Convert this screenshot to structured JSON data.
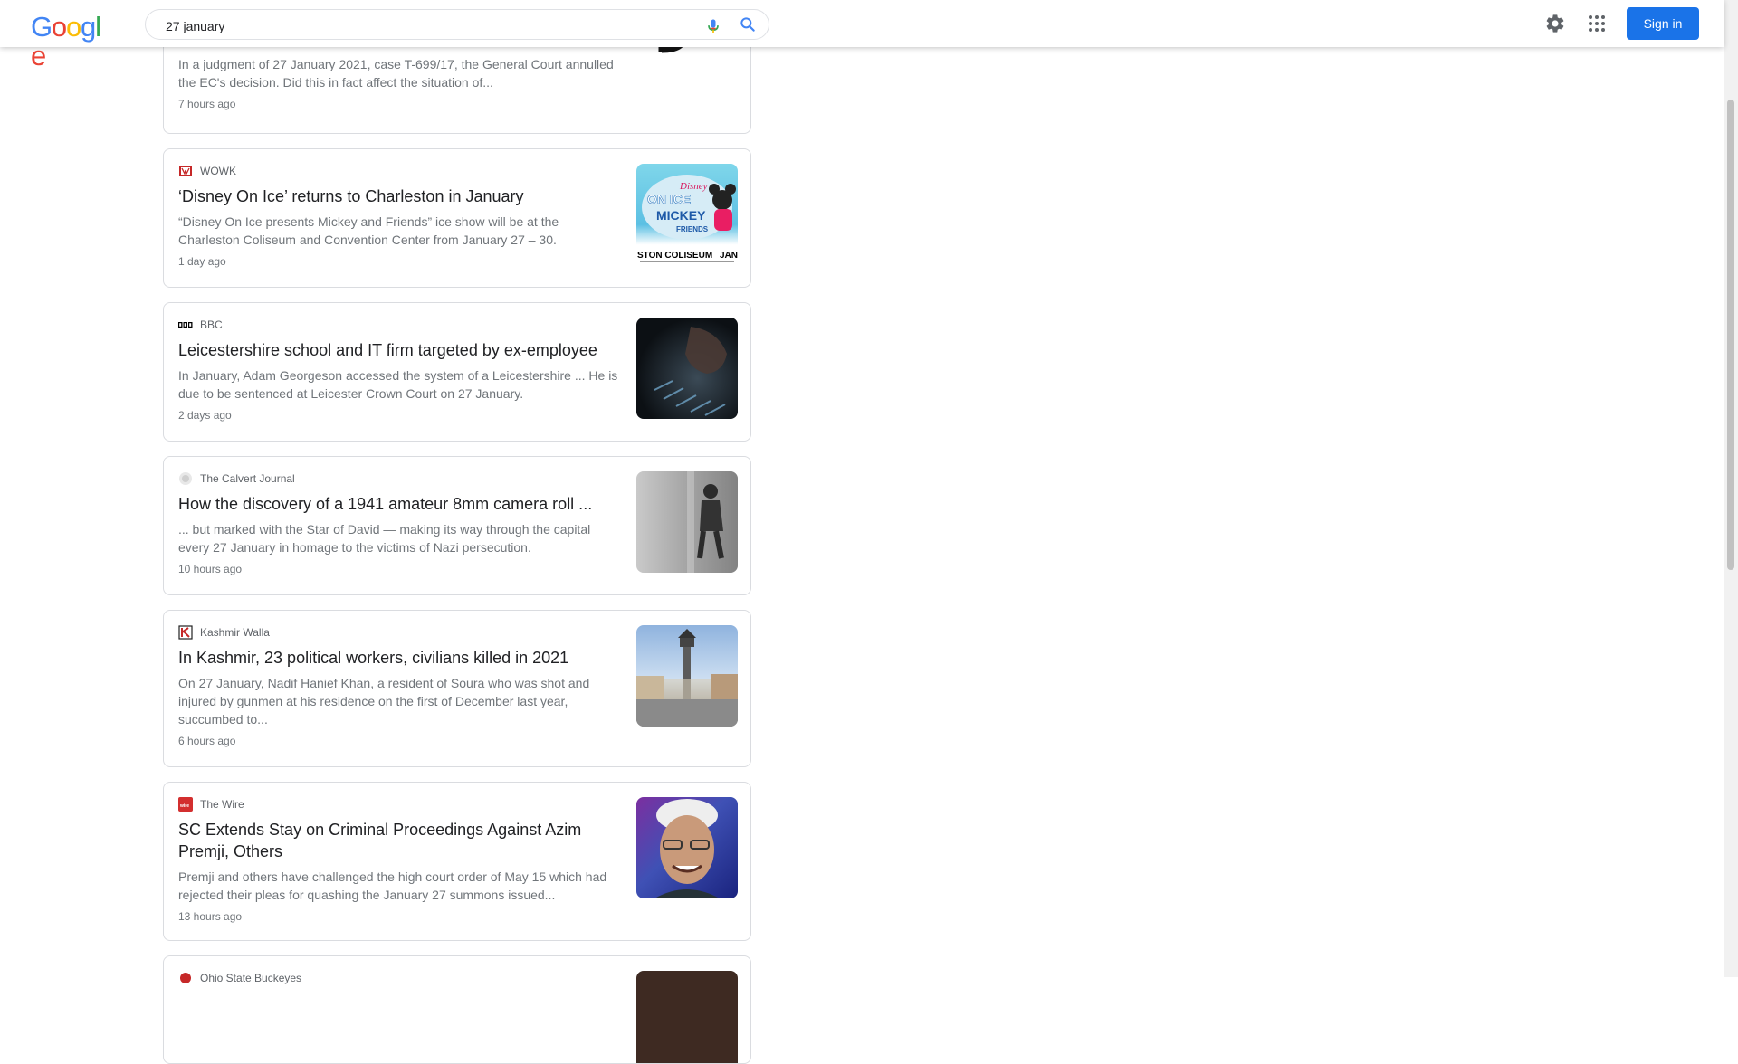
{
  "search": {
    "query": "27 january",
    "placeholder": ""
  },
  "header": {
    "logo": [
      "G",
      "o",
      "o",
      "g",
      "l",
      "e"
    ],
    "sign_in_label": "Sign in"
  },
  "results": [
    {
      "source": "",
      "title": "...",
      "snippet": "In a judgment of 27 January 2021, case T-699/17, the General Court annulled the EC's decision. Did this in fact affect the situation of...",
      "time": "7 hours ago"
    },
    {
      "source": "WOWK",
      "title": "‘Disney On Ice’ returns to Charleston in January",
      "snippet": "“Disney On Ice presents Mickey and Friends” ice show will be at the Charleston Coliseum and Convention Center from January 27 – 30.",
      "time": "1 day ago",
      "thumb_text": [
        "Disney",
        "ON ICE",
        "MICKEY",
        "FRIENDS",
        "STON COLISEUM",
        "JAN"
      ]
    },
    {
      "source": "BBC",
      "title": "Leicestershire school and IT firm targeted by ex-employee",
      "snippet": "In January, Adam Georgeson accessed the system of a Leicestershire ... He is due to be sentenced at Leicester Crown Court on 27 January.",
      "time": "2 days ago"
    },
    {
      "source": "The Calvert Journal",
      "title": "How the discovery of a 1941 amateur 8mm camera roll ...",
      "snippet": "... but marked with the Star of David — making its way through the capital every 27 January in homage to the victims of Nazi persecution.",
      "time": "10 hours ago"
    },
    {
      "source": "Kashmir Walla",
      "title": "In Kashmir, 23 political workers, civilians killed in 2021",
      "snippet": "On 27 January, Nadif Hanief Khan, a resident of Soura who was shot and injured by gunmen at his residence on the first of December last year, succumbed to...",
      "time": "6 hours ago"
    },
    {
      "source": "The Wire",
      "title": "SC Extends Stay on Criminal Proceedings Against Azim Premji, Others",
      "snippet": "Premji and others have challenged the high court order of May 15 which had rejected their pleas for quashing the January 27 summons issued...",
      "time": "13 hours ago"
    },
    {
      "source": "Ohio State Buckeyes",
      "title": "",
      "snippet": "",
      "time": ""
    }
  ],
  "colors": {
    "google_blue": "#4285F4",
    "google_red": "#EA4335",
    "google_yellow": "#FBBC05",
    "google_green": "#34A853",
    "sign_in_bg": "#1a73e8"
  }
}
